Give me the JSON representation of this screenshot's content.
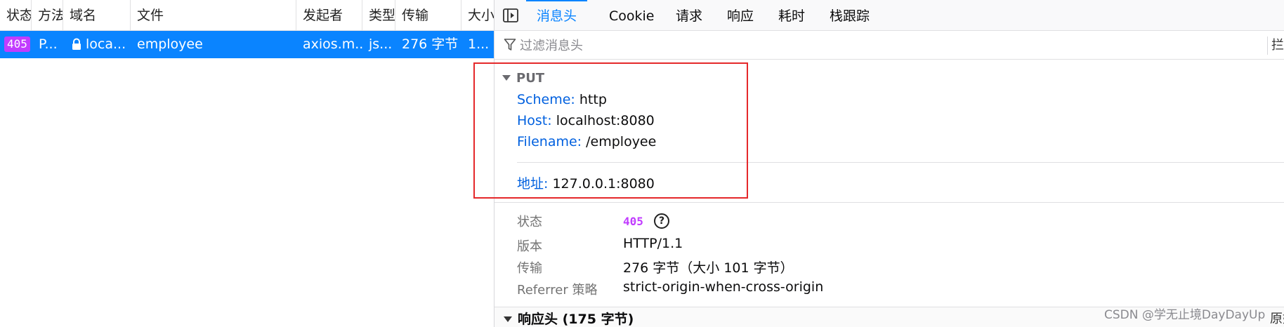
{
  "request_table": {
    "columns": [
      "状态",
      "方法",
      "域名",
      "文件",
      "发起者",
      "类型",
      "传输",
      "大小"
    ],
    "row": {
      "status": "405",
      "method": "P...",
      "domain": "loca...",
      "file": "employee",
      "initiator": "axios.m...",
      "type": "js...",
      "transferred": "276 字节",
      "size": "1..."
    }
  },
  "tabs": [
    "消息头",
    "Cookie",
    "请求",
    "响应",
    "耗时",
    "栈跟踪"
  ],
  "active_tab": "消息头",
  "filter": {
    "placeholder": "过滤消息头",
    "extra": "拦"
  },
  "request_summary": {
    "method": "PUT",
    "scheme_label": "Scheme:",
    "scheme_value": "http",
    "host_label": "Host:",
    "host_value": "localhost:8080",
    "filename_label": "Filename:",
    "filename_value": "/employee",
    "address_label": "地址:",
    "address_value": "127.0.0.1:8080"
  },
  "status_info": {
    "status_label": "状态",
    "status_value": "405",
    "version_label": "版本",
    "version_value": "HTTP/1.1",
    "transfer_label": "传输",
    "transfer_value": "276 字节（大小 101 字节）",
    "referrer_label": "Referrer 策略",
    "referrer_value": "strict-origin-when-cross-origin"
  },
  "response_headers": {
    "title": "响应头 (175 字节)",
    "right_label": "原始"
  },
  "watermark": "CSDN @学无止境DayDayUp",
  "colors": {
    "accent": "#0a84ff",
    "status_badge": "#c13cff",
    "highlight_box": "#e5282a",
    "key_blue": "#0060df"
  }
}
